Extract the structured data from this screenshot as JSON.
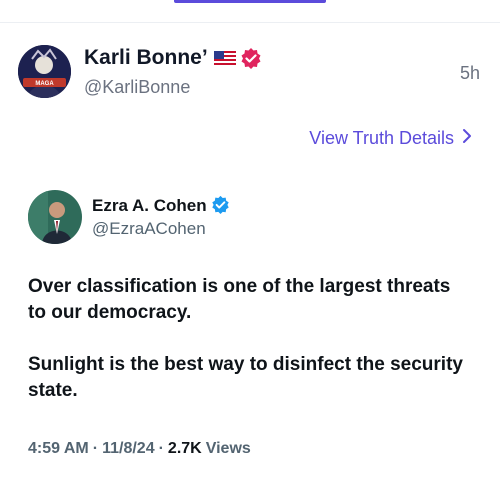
{
  "post": {
    "author_name": "Karli Bonne’",
    "flag": "🇺🇸",
    "handle": "@KarliBonne",
    "time": "5h",
    "avatar_label": "MAGA"
  },
  "details_link": {
    "label": "View Truth Details",
    "chevron": "›"
  },
  "embed": {
    "author_name": "Ezra A. Cohen",
    "handle": "@EzraACohen",
    "paragraphs": [
      "Over classification is one of the largest threats to our democracy.",
      "Sunlight is the best way to disinfect the security state."
    ],
    "meta": {
      "time": "4:59 AM",
      "date": "11/8/24",
      "views": "2.7K",
      "views_label": "Views"
    }
  },
  "colors": {
    "accent": "#5b4bdb",
    "verified_truth": "#e0245e",
    "verified_x": "#1d9bf0"
  }
}
